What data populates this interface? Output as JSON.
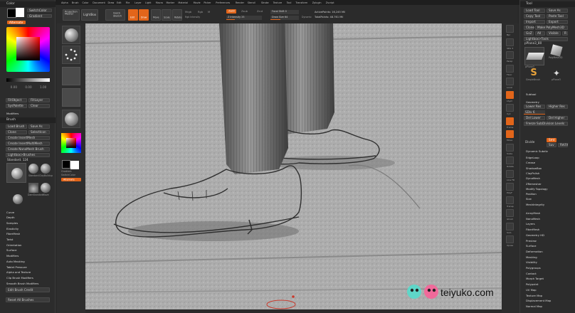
{
  "menubar": [
    "Alpha",
    "Brush",
    "Color",
    "Document",
    "Draw",
    "Edit",
    "File",
    "Layer",
    "Light",
    "Macro",
    "Marker",
    "Material",
    "Movie",
    "Picker",
    "Preferences",
    "Render",
    "Stencil",
    "Stroke",
    "Texture",
    "Tool",
    "Transform",
    "Zplugin",
    "Zscript"
  ],
  "colors": {
    "accent": "#e2651a",
    "bg": "#2a2a2a",
    "panel": "#303030",
    "canvas": "#a8a8a8"
  },
  "left_panel": {
    "color_title": "Color",
    "switch_color": "SwitchColor",
    "gradient": "Gradient",
    "alternate": "Alternate",
    "rgb_values": [
      "0.00",
      "0.00",
      "1.00"
    ],
    "fill_object": "FillObject",
    "fill_layer": "FillLayer",
    "sys_palette": "SysPalette",
    "clear": "Clear",
    "modifiers": "Modifiers",
    "brush_title": "Brush",
    "load_brush": "Load Brush",
    "save_as": "Save As",
    "clone": "Clone",
    "select_icon": "SelectIcon",
    "create_insert_mesh": "Create InsertMesh",
    "create_multimesh": "Create InsertMultiMesh",
    "create_nanomesh": "Create NanoMesh Brush",
    "lightbox_brushes": "Lightbox>Brushes",
    "brush_name": "Standard. 124",
    "thumb_labels": [
      "Standard",
      "ClayBuildup",
      "DamStandard",
      "Move"
    ],
    "subsections": [
      "Curve",
      "Depth",
      "Samples",
      "Elasticity",
      "FiberMesh",
      "Twist",
      "Orientation",
      "Surface",
      "Modifiers",
      "Auto Masking",
      "Tablet Pressure",
      "Alpha and Texture",
      "Clip Brush Modifiers",
      "Smooth Brush Modifiers"
    ],
    "edit_brush_credit": "Edit Brush Credit",
    "reset_all_brushes": "Reset All Brushes"
  },
  "shelf": {
    "switch_color": "SwitchColor",
    "gradient": "Gradient",
    "alternate": "Alternate"
  },
  "top_toolbar": {
    "projection_master": "Projection Master",
    "lightbox": "LightBox",
    "quick_sketch": "Quick Sketch",
    "edit": "Edit",
    "draw": "Draw",
    "move": "Move",
    "scale": "Scale",
    "rotate": "Rotate",
    "mrgb": "Mrgb",
    "rgb": "Rgb",
    "m": "M",
    "zadd": "Zadd",
    "zsub": "Zsub",
    "zcut": "Zcut",
    "rgb_intensity": "Rgb Intensity",
    "z_intensity": "Z Intensity 25",
    "focal_shift": "Focal Shift 0",
    "draw_size": "Draw Size 64",
    "dynamic": "Dynamic",
    "active_points": "ActivePoints: 16,245 Mil",
    "total_points": "TotalPoints: 48.761 Mil"
  },
  "right_panel": {
    "tool_title": "Tool",
    "load_tool": "Load Tool",
    "save_as": "Save As",
    "copy_tool": "Copy Tool",
    "paste_tool": "Paste Tool",
    "import": "Import",
    "export": "Export",
    "clone": "Clone",
    "make_polymesh": "Make PolyMesh3D",
    "goz": "GoZ",
    "all": "All",
    "visible": "Visible",
    "r": "R",
    "lightbox_tools": "Lightbox>Tools",
    "current_tool": "pPlane3_80",
    "tool_labels": [
      "pPlane3",
      "PolyMesh3D",
      "SimpleBrush",
      "pPlane3"
    ],
    "subtool": "Subtool",
    "geometry": "Geometry",
    "lower_res": "Lower Res",
    "higher_res": "Higher Res",
    "sdiv": "SDiv 6",
    "del_lower": "Del Lower",
    "del_higher": "Del Higher",
    "freeze": "Freeze SubDivision Levels",
    "divide": "Divide",
    "smt": "Smt",
    "suv": "Suv",
    "reuv": "ReUV",
    "dynamic_subdiv": "Dynamic Subdiv",
    "subsections": [
      "EdgeLoop",
      "Crease",
      "ShadowBox",
      "ClayPolish",
      "DynaMesh",
      "ZRemesher",
      "Modify Topology",
      "Position",
      "Size",
      "MeshIntegrity"
    ],
    "lower_subsections": [
      "ArrayMesh",
      "NanoMesh",
      "Layers",
      "FiberMesh",
      "Geometry HD",
      "Preview",
      "Surface",
      "Deformation",
      "Masking",
      "Visibility",
      "Polygroups",
      "Contact",
      "Morph Target",
      "Polypaint",
      "UV Map",
      "Texture Map",
      "Displacement Map",
      "Normal Map"
    ]
  },
  "side_icons": [
    "Bpr",
    "SPix 3",
    "Persp",
    "Floor",
    "Local",
    "LSym",
    "Xyz",
    "Frame",
    "Move",
    "Scale",
    "Rotate",
    "Line Fill",
    "PolyF",
    "Transp",
    "Ghost",
    "Solo",
    "Xpose"
  ],
  "watermark": "teiyuko.com",
  "left_icon_labels": [
    "Scroll",
    "Zoom",
    "Actual",
    "AAHalf",
    "Dynamic"
  ]
}
